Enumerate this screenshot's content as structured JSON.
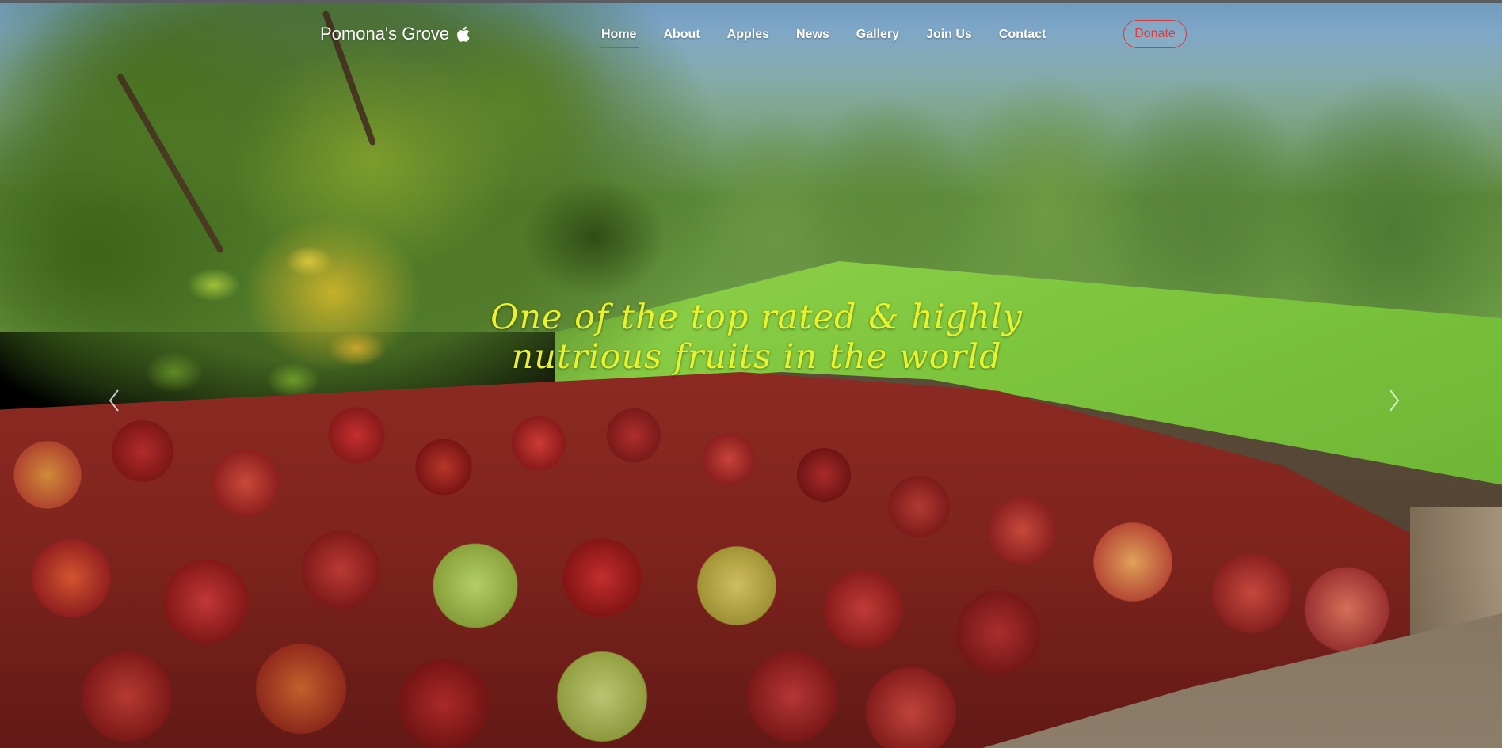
{
  "brand": {
    "name": "Pomona's Grove",
    "icon": "apple-icon"
  },
  "nav": {
    "items": [
      {
        "label": "Home",
        "active": true
      },
      {
        "label": "About",
        "active": false
      },
      {
        "label": "Apples",
        "active": false
      },
      {
        "label": "News",
        "active": false
      },
      {
        "label": "Gallery",
        "active": false
      },
      {
        "label": "Join Us",
        "active": false
      },
      {
        "label": "Contact",
        "active": false
      }
    ],
    "donate_label": "Donate"
  },
  "hero": {
    "tagline_line1": "One of the top rated & highly",
    "tagline_line2": "nutrious fruits in the world",
    "prev_icon": "chevron-left-icon",
    "next_icon": "chevron-right-icon"
  },
  "colors": {
    "accent": "#e0403a",
    "tagline": "#e9f22b",
    "nav_text": "#ffffff"
  }
}
